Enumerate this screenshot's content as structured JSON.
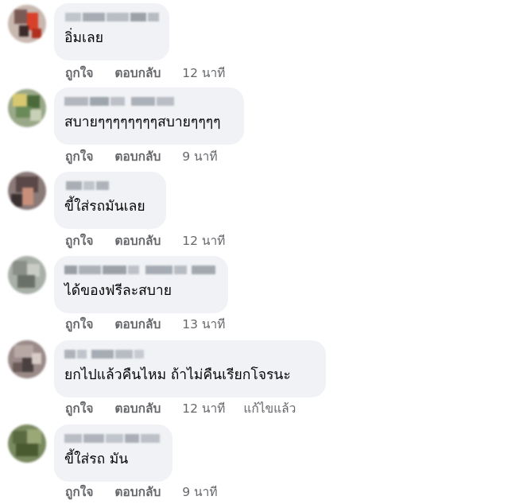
{
  "comments": [
    {
      "text": "อิ่มเลย",
      "like_label": "ถูกใจ",
      "reply_label": "ตอบกลับ",
      "time": "12 นาที",
      "edited": ""
    },
    {
      "text": "สบายๆๆๆๆๆๆๆๆสบายๆๆๆๆ",
      "like_label": "ถูกใจ",
      "reply_label": "ตอบกลับ",
      "time": "9 นาที",
      "edited": ""
    },
    {
      "text": "ขี้ใส่รถมันเลย",
      "like_label": "ถูกใจ",
      "reply_label": "ตอบกลับ",
      "time": "12 นาที",
      "edited": ""
    },
    {
      "text": "ได้ของฟรีละสบาย",
      "like_label": "ถูกใจ",
      "reply_label": "ตอบกลับ",
      "time": "13 นาที",
      "edited": ""
    },
    {
      "text": "ยกไปแล้วคืนไหม ถ้าไม่คืนเรียกโจรนะ",
      "like_label": "ถูกใจ",
      "reply_label": "ตอบกลับ",
      "time": "12 นาที",
      "edited": "แก้ไขแล้ว"
    },
    {
      "text": "ขี้ใส่รถ มัน",
      "like_label": "ถูกใจ",
      "reply_label": "ตอบกลับ",
      "time": "9 นาที",
      "edited": ""
    }
  ],
  "colors": {
    "bubble": "#f0f2f5",
    "meta": "#65676b",
    "text": "#050505"
  }
}
